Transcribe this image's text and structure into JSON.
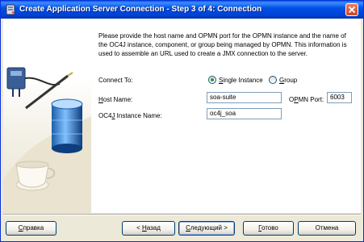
{
  "window": {
    "title": "Create Application Server Connection - Step 3 of 4: Connection",
    "icons": {
      "app": "server-connection-icon",
      "close": "close-icon"
    }
  },
  "content": {
    "description": "Please provide the host name and OPMN port for the OPMN instance and the name of the OC4J instance, component, or group being managed by OPMN. This information is used to assemble an URL used to create a JMX connection to the server.",
    "connect_to_label": "Connect To:",
    "options": [
      {
        "key": "S",
        "rest": "ingle Instance",
        "selected": true
      },
      {
        "key": "G",
        "rest": "roup",
        "selected": false
      }
    ],
    "host_name": {
      "key": "H",
      "rest": "ost Name:",
      "value": "soa-suite"
    },
    "opmn_port": {
      "pre": "O",
      "key": "P",
      "rest": "MN Port:",
      "value": "6003"
    },
    "oc4j": {
      "pre": "OC4",
      "key": "J",
      "rest": " Instance Name:",
      "value": "oc4j_soa"
    }
  },
  "buttons": {
    "help": {
      "key": "С",
      "rest": "правка"
    },
    "back": {
      "pre": "< ",
      "key": "Н",
      "rest": "азад"
    },
    "next": {
      "key": "С",
      "rest": "ледующий >"
    },
    "finish": {
      "key": "Г",
      "rest": "отово"
    },
    "cancel": {
      "label": "Отмена"
    }
  },
  "colors": {
    "titlebar": "#0050e6",
    "accent_radio": "#21a121",
    "field_border": "#7f9db9"
  }
}
